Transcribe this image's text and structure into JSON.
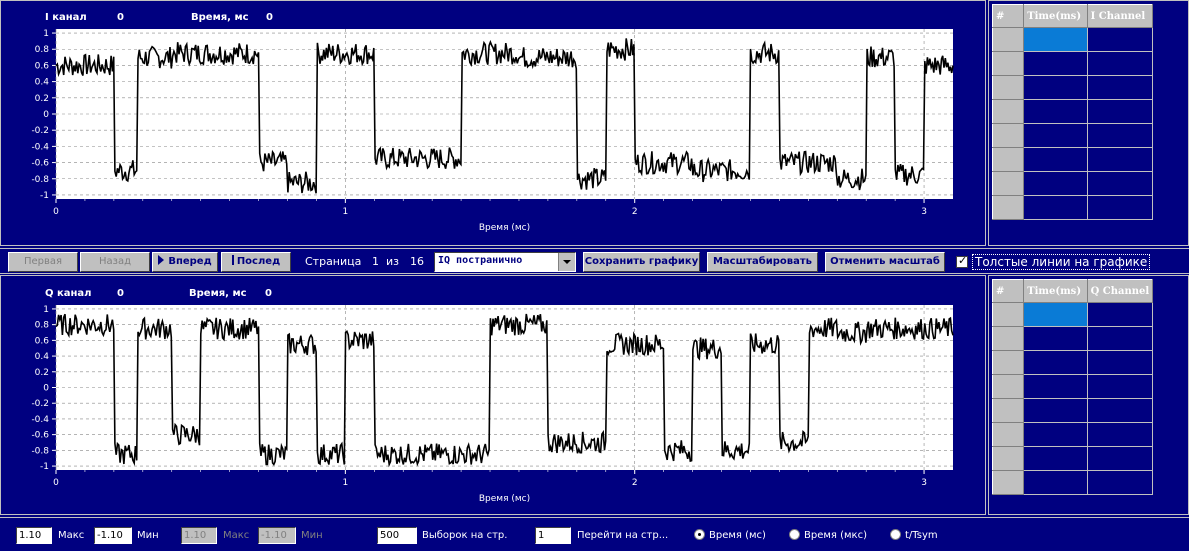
{
  "top_chart": {
    "channel_label": "I канал",
    "channel_value": "0",
    "time_label": "Время, мс",
    "time_value": "0",
    "xlabel": "Время (мс)",
    "y_ticks": [
      "1",
      "0.8",
      "0.6",
      "0.4",
      "0.2",
      "0",
      "-0.2",
      "-0.4",
      "-0.6",
      "-0.8",
      "-1"
    ],
    "x_ticks": [
      "0",
      "1",
      "2",
      "3"
    ]
  },
  "bottom_chart": {
    "channel_label": "Q канал",
    "channel_value": "0",
    "time_label": "Время, мс",
    "time_value": "0",
    "xlabel": "Время (мс)",
    "y_ticks": [
      "1",
      "0.8",
      "0.6",
      "0.4",
      "0.2",
      "0",
      "-0.2",
      "-0.4",
      "-0.6",
      "-0.8",
      "-1"
    ],
    "x_ticks": [
      "0",
      "1",
      "2",
      "3"
    ]
  },
  "top_table": {
    "columns": [
      "#",
      "Time(ms)",
      "I Channel"
    ]
  },
  "bottom_table": {
    "columns": [
      "#",
      "Time(ms)",
      "Q Channel"
    ]
  },
  "toolbar": {
    "first": "Первая",
    "back": "Назад",
    "forward": "Вперед",
    "last": "Послед",
    "page_prefix": "Страница",
    "page_current": "1",
    "page_of": "из",
    "page_total": "16",
    "mode_select": "IQ постранично",
    "save_graph": "Сохранить графику",
    "scale": "Масштабировать",
    "cancel_scale": "Отменить масштаб",
    "thick_lines": "Толстые линии на графике"
  },
  "bottom_bar": {
    "max1_value": "1.10",
    "max1_label": "Макс",
    "min1_value": "-1.10",
    "min1_label": "Мин",
    "max2_value": "1.10",
    "max2_label": "Макс",
    "min2_value": "-1.10",
    "min2_label": "Мин",
    "samples_value": "500",
    "samples_label": "Выборок на стр.",
    "goto_value": "1",
    "goto_label": "Перейти на стр...",
    "radio_ms": "Время (мс)",
    "radio_us": "Время (мкс)",
    "radio_tsym": "t/Tsym"
  },
  "chart_data": [
    {
      "type": "line",
      "title": "I канал",
      "xlabel": "Время (мс)",
      "xlim": [
        0,
        3.1
      ],
      "ylim": [
        -1.05,
        1.05
      ],
      "grid": true,
      "levels": [
        [
          0,
          0.2,
          0.6
        ],
        [
          0.2,
          0.28,
          -0.7
        ],
        [
          0.28,
          0.4,
          0.7
        ],
        [
          0.4,
          0.7,
          0.75
        ],
        [
          0.7,
          0.8,
          -0.6
        ],
        [
          0.8,
          0.9,
          -0.85
        ],
        [
          0.9,
          1.1,
          0.75
        ],
        [
          1.1,
          1.4,
          -0.55
        ],
        [
          1.4,
          1.6,
          0.75
        ],
        [
          1.6,
          1.8,
          0.7
        ],
        [
          1.8,
          1.9,
          -0.8
        ],
        [
          1.9,
          2.0,
          0.8
        ],
        [
          2.0,
          2.2,
          -0.6
        ],
        [
          2.2,
          2.4,
          -0.7
        ],
        [
          2.4,
          2.5,
          0.75
        ],
        [
          2.5,
          2.7,
          -0.6
        ],
        [
          2.7,
          2.8,
          -0.8
        ],
        [
          2.8,
          2.9,
          0.7
        ],
        [
          2.9,
          3.0,
          -0.75
        ],
        [
          3.0,
          3.1,
          0.6
        ]
      ]
    },
    {
      "type": "line",
      "title": "Q канал",
      "xlabel": "Время (мс)",
      "xlim": [
        0,
        3.1
      ],
      "ylim": [
        -1.05,
        1.05
      ],
      "grid": true,
      "levels": [
        [
          0,
          0.2,
          0.8
        ],
        [
          0.2,
          0.28,
          -0.85
        ],
        [
          0.28,
          0.4,
          0.75
        ],
        [
          0.4,
          0.5,
          -0.6
        ],
        [
          0.5,
          0.7,
          0.75
        ],
        [
          0.7,
          0.8,
          -0.85
        ],
        [
          0.8,
          0.9,
          0.55
        ],
        [
          0.9,
          1.0,
          -0.85
        ],
        [
          1.0,
          1.1,
          0.6
        ],
        [
          1.1,
          1.5,
          -0.85
        ],
        [
          1.5,
          1.7,
          0.8
        ],
        [
          1.7,
          1.9,
          -0.7
        ],
        [
          1.9,
          2.1,
          0.55
        ],
        [
          2.1,
          2.2,
          -0.8
        ],
        [
          2.2,
          2.3,
          0.5
        ],
        [
          2.3,
          2.4,
          -0.8
        ],
        [
          2.4,
          2.5,
          0.55
        ],
        [
          2.5,
          2.6,
          -0.7
        ],
        [
          2.6,
          2.7,
          0.75
        ],
        [
          2.7,
          2.8,
          0.7
        ],
        [
          2.8,
          3.1,
          0.75
        ]
      ]
    }
  ]
}
